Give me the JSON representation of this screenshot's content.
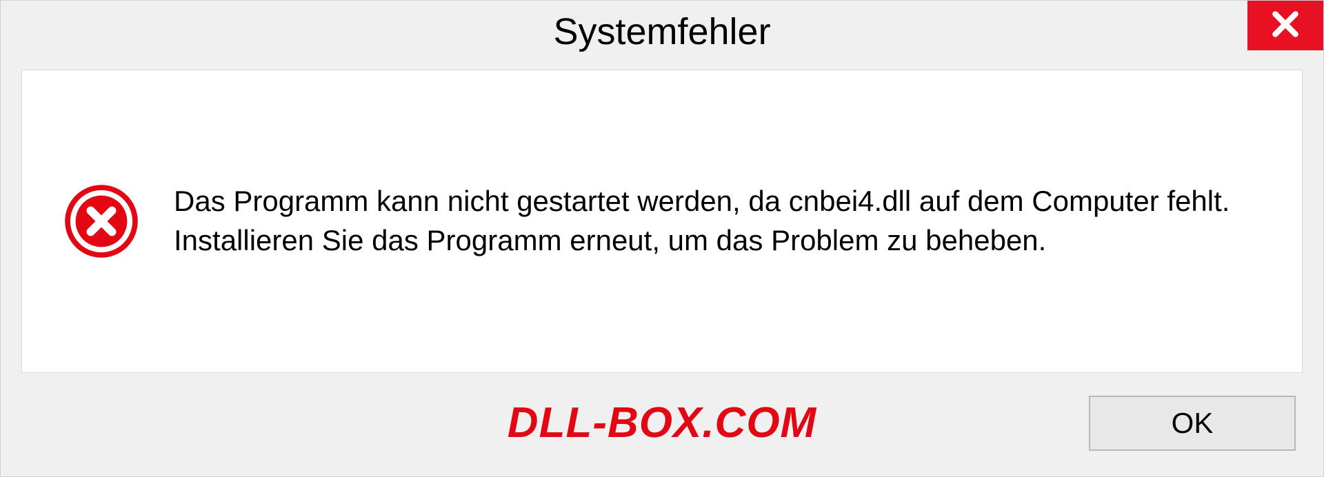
{
  "dialog": {
    "title": "Systemfehler",
    "message": "Das Programm kann nicht gestartet werden, da cnbei4.dll auf dem Computer fehlt. Installieren Sie das Programm erneut, um das Problem zu beheben.",
    "ok_label": "OK"
  },
  "watermark": "DLL-BOX.COM"
}
